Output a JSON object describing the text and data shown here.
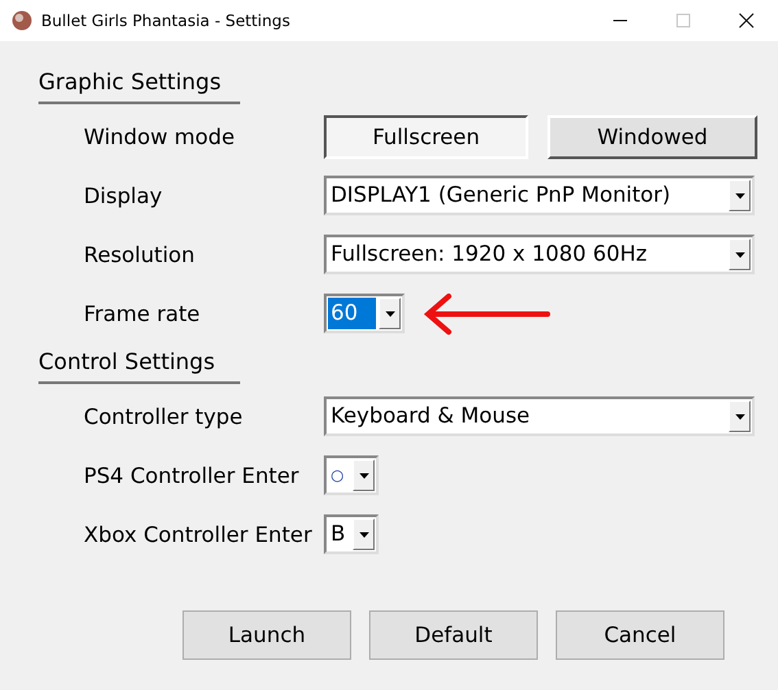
{
  "window": {
    "title": "Bullet Girls Phantasia - Settings",
    "controls": [
      {
        "kind": "minimize"
      },
      {
        "kind": "maximize",
        "disabled": true
      },
      {
        "kind": "close"
      }
    ]
  },
  "sections": [
    {
      "title": "Graphic Settings",
      "rows": [
        {
          "label": "Window mode",
          "kind": "toggle",
          "options": [
            {
              "label": "Fullscreen",
              "selected": true
            },
            {
              "label": "Windowed",
              "selected": false
            }
          ]
        },
        {
          "label": "Display",
          "kind": "wideselect",
          "value": "DISPLAY1 (Generic PnP Monitor)",
          "highlighted": false
        },
        {
          "label": "Resolution",
          "kind": "wideselect",
          "value": "Fullscreen: 1920 x 1080  60Hz",
          "highlighted": false
        },
        {
          "label": "Frame rate",
          "kind": "smallselect",
          "value": "60",
          "highlighted": true,
          "arrow": true
        }
      ]
    },
    {
      "title": "Control Settings",
      "rows": [
        {
          "label": "Controller type",
          "kind": "wideselect",
          "value": "Keyboard & Mouse",
          "highlighted": false
        },
        {
          "label": "PS4 Controller Enter",
          "kind": "tinyselect",
          "value": "○",
          "highlighted": false,
          "symbol": true
        },
        {
          "label": "Xbox Controller Enter",
          "kind": "tinyselect",
          "value": "B",
          "highlighted": false
        }
      ]
    }
  ],
  "buttons": [
    "Launch",
    "Default",
    "Cancel"
  ]
}
